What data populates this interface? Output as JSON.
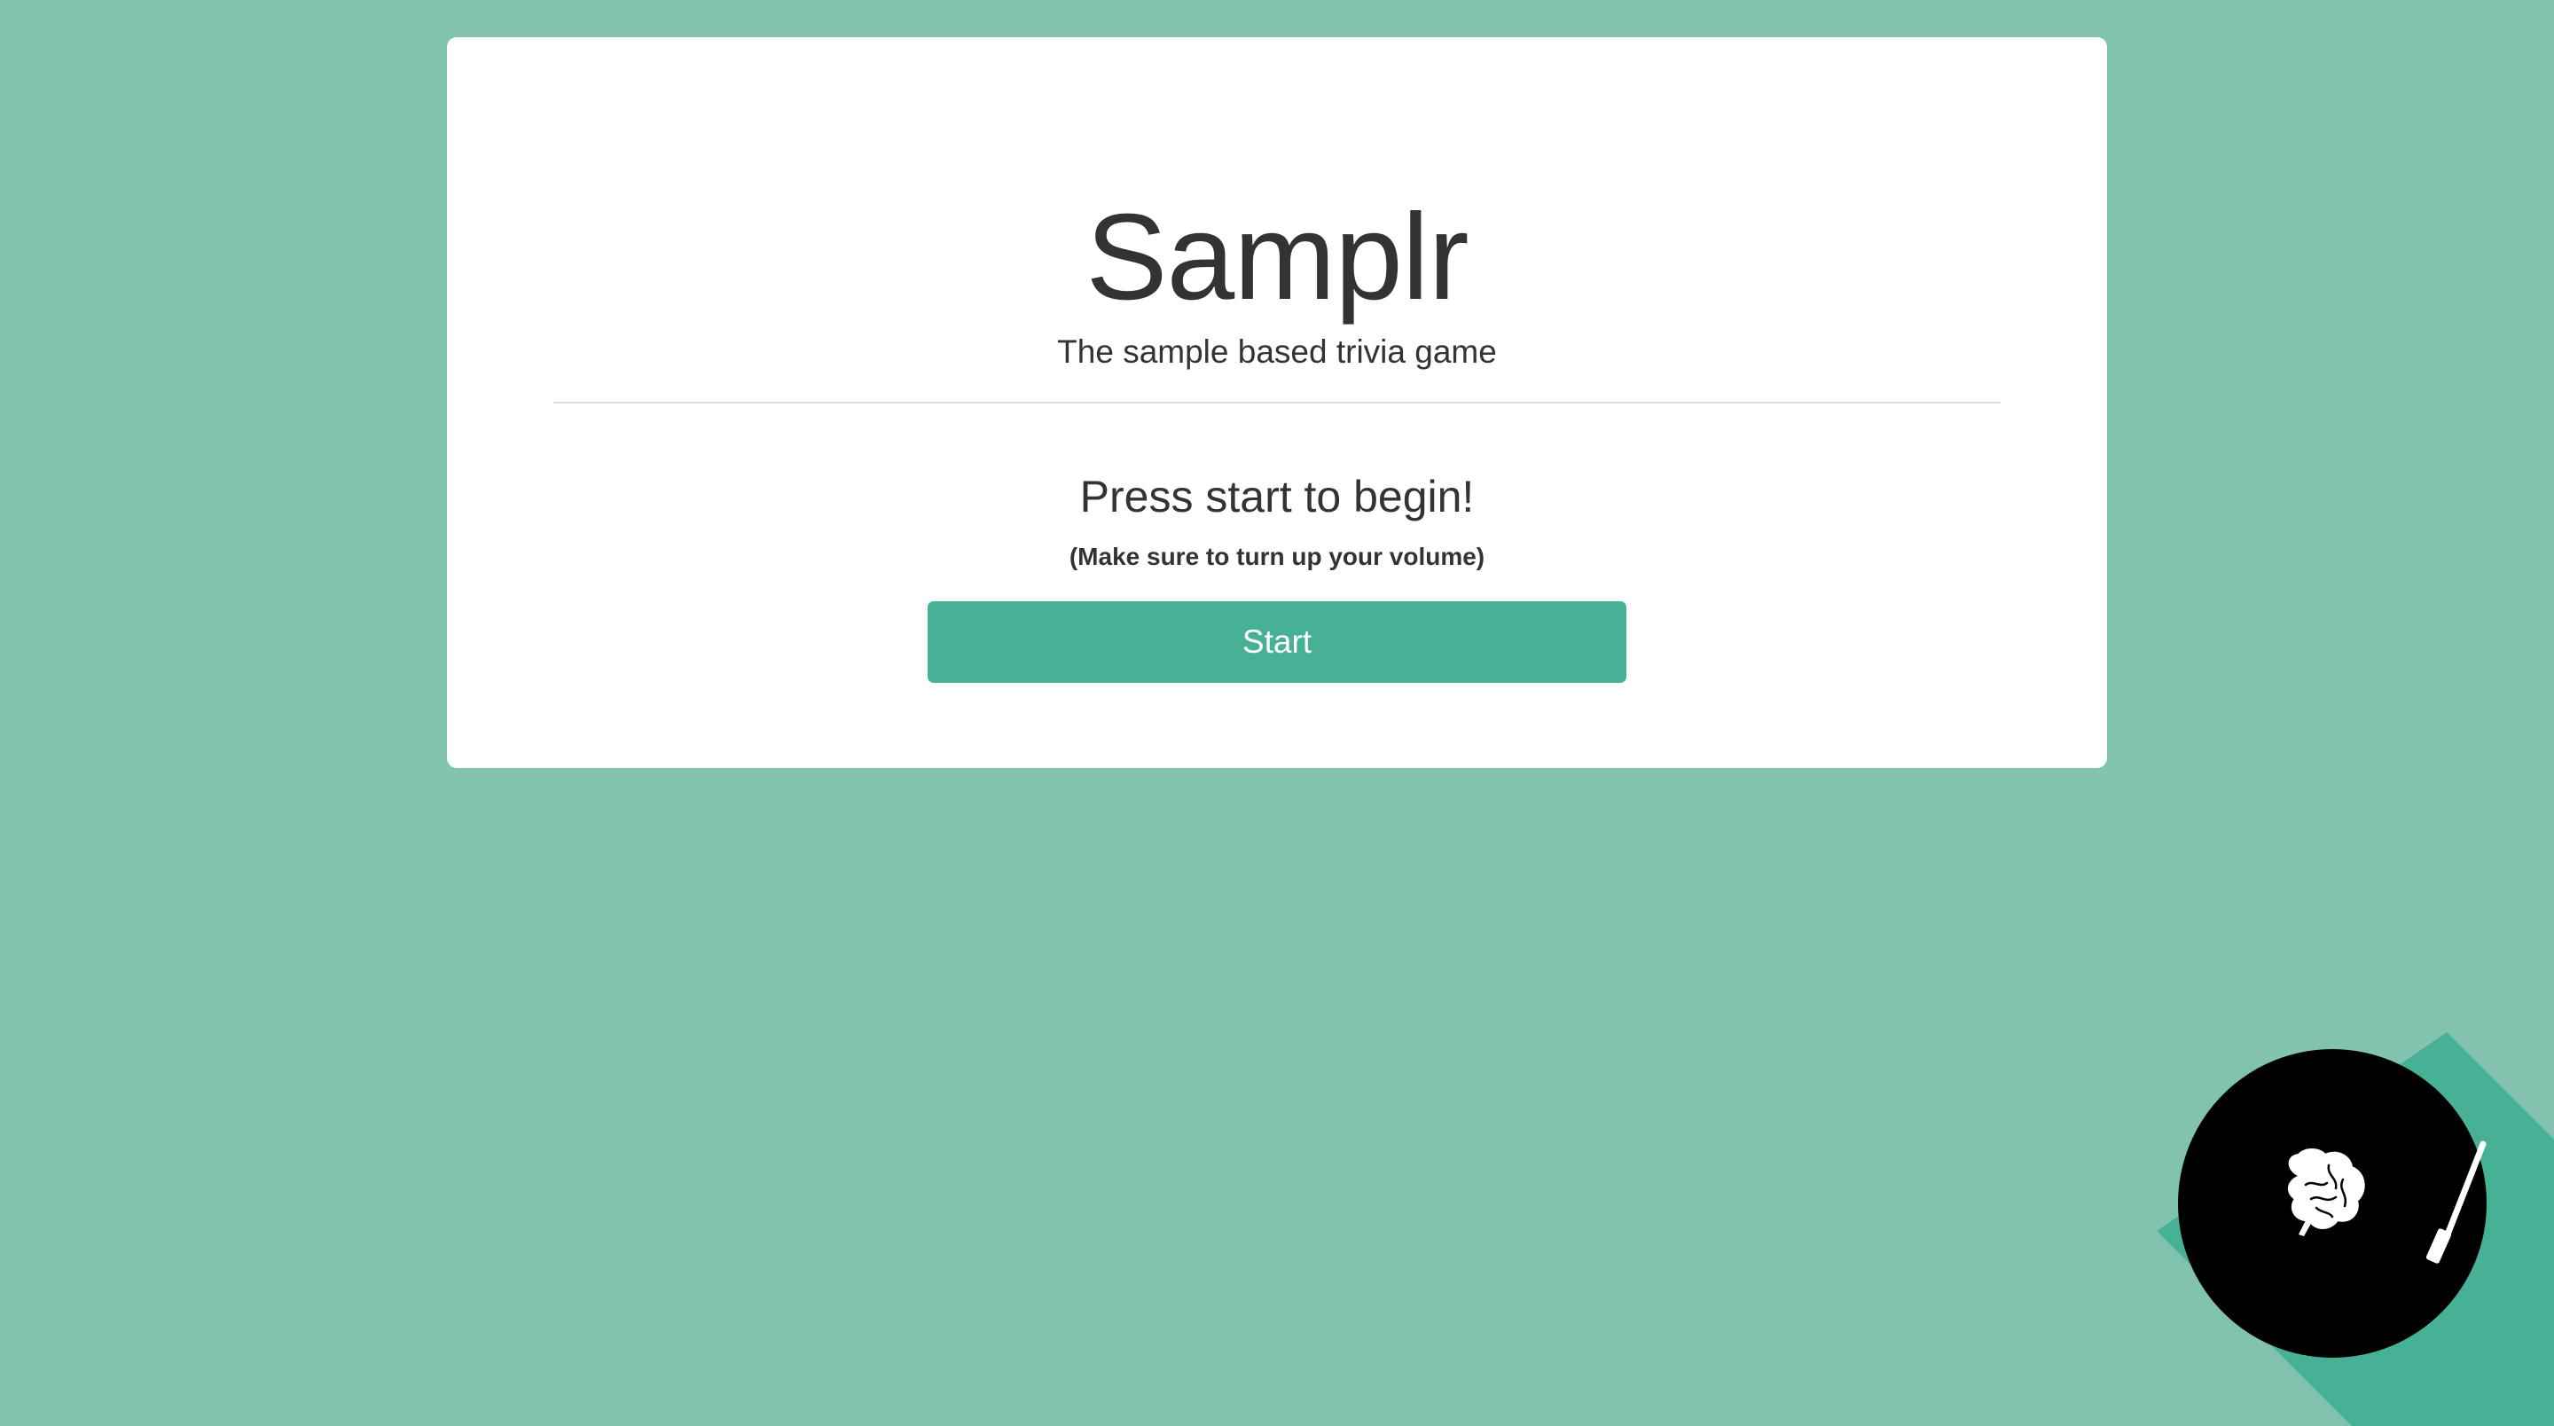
{
  "app": {
    "title": "Samplr",
    "subtitle": "The sample based trivia game"
  },
  "intro": {
    "prompt": "Press start to begin!",
    "hint": "(Make sure to turn up your volume)"
  },
  "actions": {
    "start_label": "Start"
  },
  "colors": {
    "background": "#82c3b0",
    "accent": "#47b196",
    "card": "#ffffff",
    "text": "#333333",
    "badge": "#000000"
  },
  "badge": {
    "icons": [
      "brain-icon",
      "needle-icon"
    ]
  }
}
